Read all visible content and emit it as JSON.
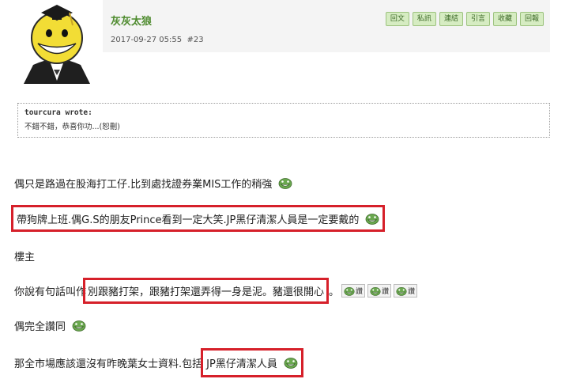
{
  "post": {
    "username": "灰灰太狼",
    "date": "2017-09-27 05:55",
    "floor": "#23",
    "actions": [
      "回文",
      "私訊",
      "連結",
      "引言",
      "收藏",
      "回報"
    ]
  },
  "quote": {
    "author": "tourcura wrote:",
    "text": "不錯不錯，恭喜你功...(恕刪)"
  },
  "lines": {
    "l1": "偶只是路過在股海打工仔.比到處找證券業MIS工作的稍強",
    "l2": "帶狗牌上班.偶G.S的朋友Prince看到一定大笑.JP黑仔清潔人員是一定要戴的",
    "l3": "樓主",
    "l4_prefix": "你說有句話叫作",
    "l4_boxed": "別跟豬打架，跟豬打架還弄得一身是泥。豬還很開心",
    "l4_suffix": "。",
    "chip_label": "讚",
    "l5": "偶完全讚同",
    "l6_prefix": "那全市場應該還沒有昨晚葉女士資料.包括",
    "l6_boxed": "JP黑仔清潔人員"
  },
  "colors": {
    "highlight": "#d6202a",
    "username": "#4d8a2d"
  },
  "icons": {
    "emoticon": "green-grin-emoticon"
  }
}
